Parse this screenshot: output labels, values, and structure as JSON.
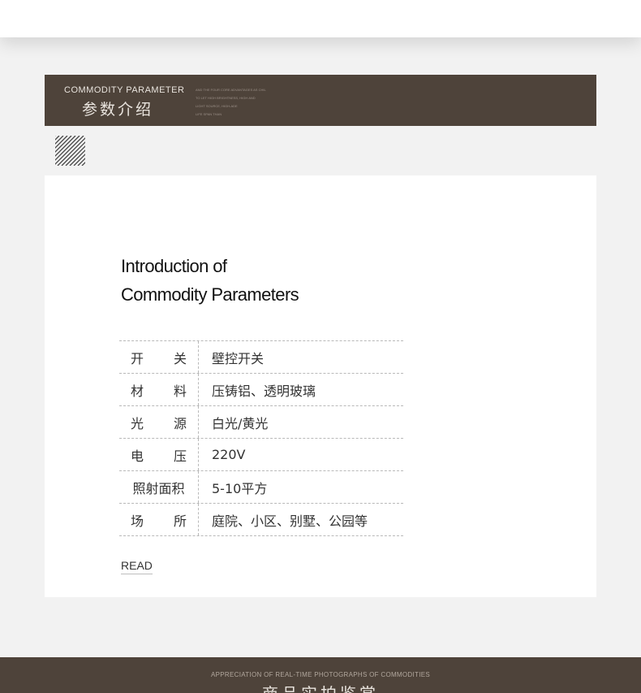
{
  "banner": {
    "title_en": "COMMODITY PARAMETER",
    "title_zh": "参数介绍",
    "fine_lines": [
      "AND THE FOUR CORE ADVANTAGES AS CHIL",
      "TO LET HIGH BRIGHTNESS, HIGH AND",
      "LIGHT SOURCE, HIGH-ADE",
      "LIFE SPAN THAN"
    ]
  },
  "icons": {
    "hatch": "diagonal-hatch-icon"
  },
  "intro": {
    "line1": "Introduction of",
    "line2": "Commodity Parameters"
  },
  "specs": [
    {
      "label": "开 关",
      "value": "壁控开关"
    },
    {
      "label": "材 料",
      "value": "压铸铝、透明玻璃"
    },
    {
      "label": "光 源",
      "value": "白光/黄光"
    },
    {
      "label": "电 压",
      "value": "220V"
    },
    {
      "label": "照射面积",
      "value": "5-10平方"
    },
    {
      "label": "场 所",
      "value": "庭院、小区、别墅、公园等"
    }
  ],
  "read_label": "READ",
  "footer": {
    "title_en": "APPRECIATION OF REAL-TIME PHOTOGRAPHS OF COMMODITIES",
    "title_zh": "商品实拍鉴赏"
  },
  "colors": {
    "banner_bg": "#4e433a",
    "page_bg": "#f2f2f2",
    "card_bg": "#ffffff"
  }
}
